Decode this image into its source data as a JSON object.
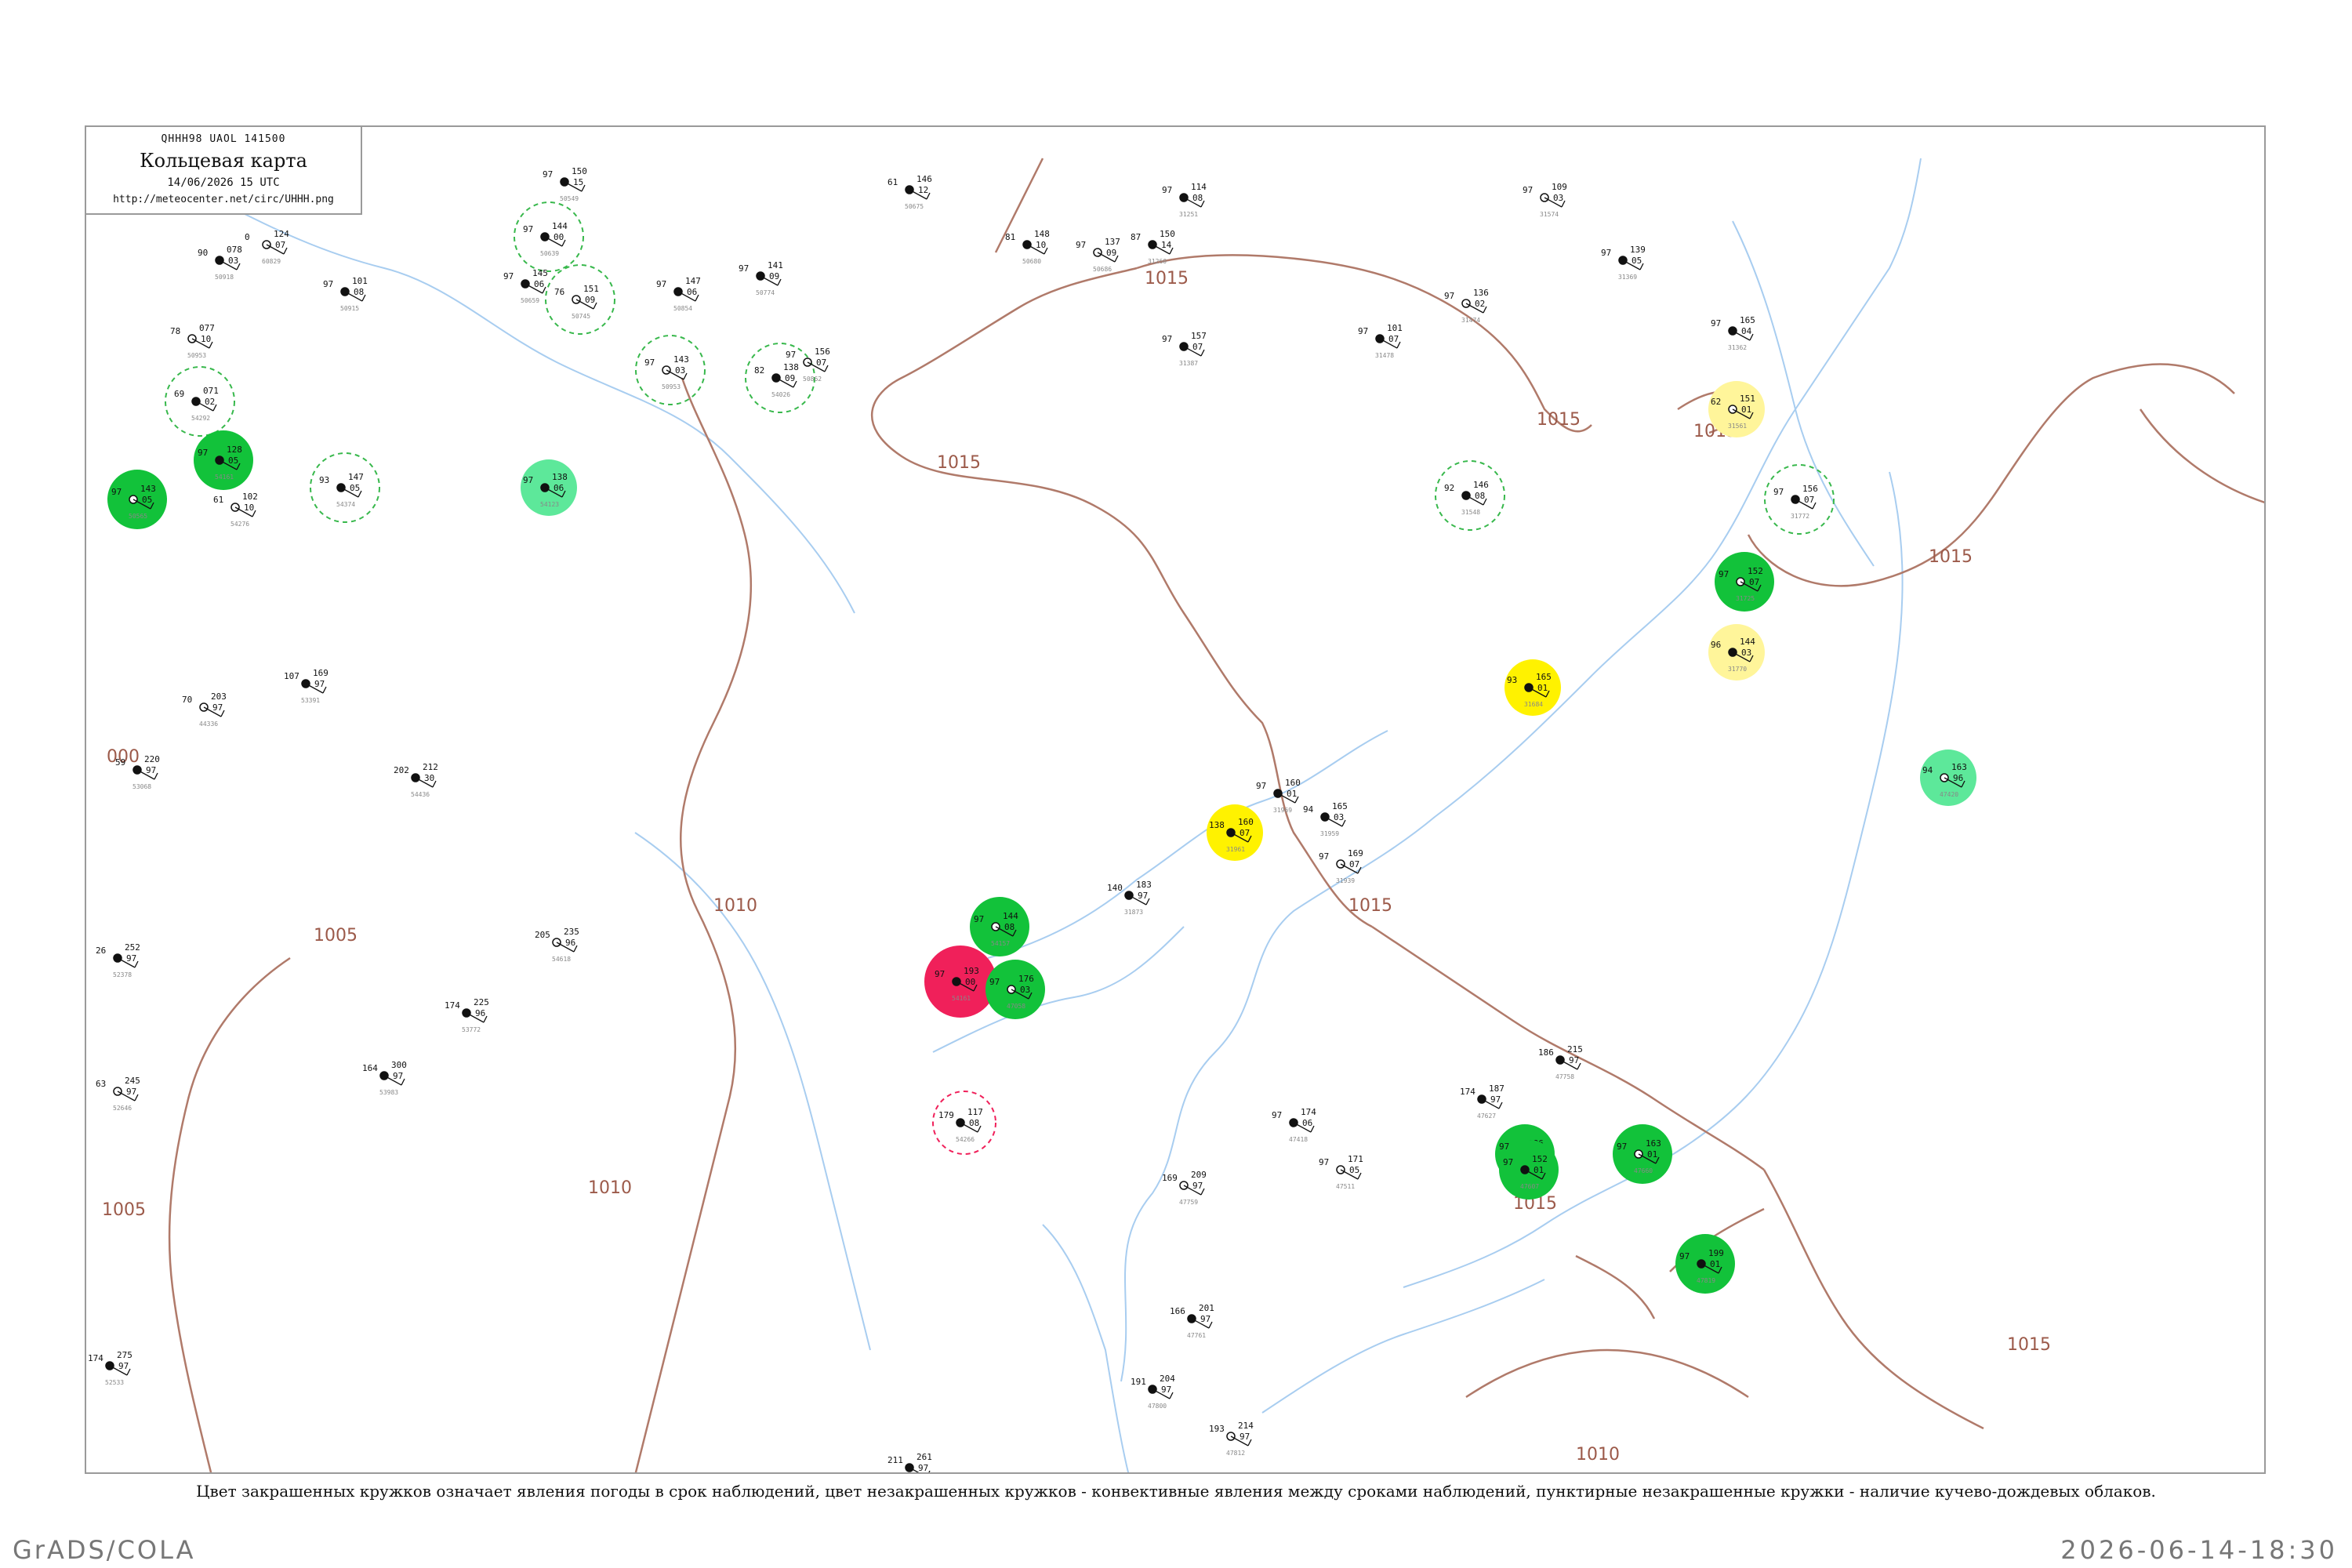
{
  "header": {
    "code": "QHHH98  UAOL  141500",
    "title": "Кольцевая карта",
    "datetime": "14/06/2026 15 UTC",
    "url": "http://meteocenter.net/circ/UHHH.png"
  },
  "caption": "Цвет закрашенных кружков означает явления погоды в срок наблюдений, цвет незакрашенных кружков - конвективные явления между сроками наблюдений, пунктирные незакрашенные кружки - наличие кучево-дождевых облаков.",
  "footer": {
    "left": "GrADS/COLA",
    "right": "2026-06-14-18:30"
  },
  "colors": {
    "isobar": "#b07a6a",
    "river": "#a8cdf0",
    "frame": "#9a9a9a",
    "rain_green": "#12c23a",
    "shower_lightgreen": "#5de89a",
    "fog_yellow": "#fff200",
    "haze_paleyellow": "#fff59a",
    "thunder_red": "#f0205a",
    "dashed_green": "#38b84c",
    "dashed_red": "#f0205a"
  },
  "isobar_labels": [
    "1015",
    "1015",
    "1015",
    "1015",
    "1015",
    "1015",
    "1015",
    "1015",
    "1010",
    "1010",
    "1010",
    "1005",
    "1005",
    "000"
  ],
  "stations": [
    {
      "p": "124",
      "t": "07",
      "ws": "0",
      "n": "60829",
      "fill": "none"
    },
    {
      "p": "078",
      "t": "03",
      "ws": "90",
      "n": "50918",
      "fill": "none"
    },
    {
      "p": "101",
      "t": "08",
      "ws": "97",
      "n": "50915",
      "fill": "none"
    },
    {
      "p": "077",
      "t": "10",
      "ws": "78",
      "n": "50953",
      "fill": "none"
    },
    {
      "p": "071",
      "t": "02",
      "ws": "69",
      "n": "54292",
      "fill": "dashed-green"
    },
    {
      "p": "128",
      "t": "05",
      "ws": "97",
      "n": "54161",
      "fill": "rain"
    },
    {
      "p": "143",
      "t": "05",
      "ws": "97",
      "n": "50565",
      "fill": "rain"
    },
    {
      "p": "147",
      "t": "05",
      "ws": "93",
      "n": "54374",
      "fill": "dashed-green"
    },
    {
      "p": "138",
      "t": "06",
      "ws": "97",
      "n": "54123",
      "fill": "shower"
    },
    {
      "p": "102",
      "t": "10",
      "ws": "61",
      "n": "54276",
      "fill": "none"
    },
    {
      "p": "150",
      "t": "15",
      "ws": "97",
      "n": "50549",
      "fill": "none"
    },
    {
      "p": "144",
      "t": "00",
      "ws": "97",
      "n": "50639",
      "fill": "dashed-green"
    },
    {
      "p": "151",
      "t": "09",
      "ws": "76",
      "n": "50745",
      "fill": "dashed-green"
    },
    {
      "p": "145",
      "t": "06",
      "ws": "97",
      "n": "50659",
      "fill": "none"
    },
    {
      "p": "147",
      "t": "06",
      "ws": "97",
      "n": "50854",
      "fill": "none"
    },
    {
      "p": "143",
      "t": "03",
      "ws": "97",
      "n": "50953",
      "fill": "dashed-green"
    },
    {
      "p": "138",
      "t": "09",
      "ws": "82",
      "n": "54026",
      "fill": "dashed-green"
    },
    {
      "p": "141",
      "t": "09",
      "ws": "97",
      "n": "50774",
      "fill": "none"
    },
    {
      "p": "156",
      "t": "07",
      "ws": "97",
      "n": "50862",
      "fill": "none"
    },
    {
      "p": "146",
      "t": "12",
      "ws": "61",
      "n": "50675",
      "fill": "none"
    },
    {
      "p": "148",
      "t": "10",
      "ws": "81",
      "n": "50680",
      "fill": "none"
    },
    {
      "p": "137",
      "t": "09",
      "ws": "97",
      "n": "50686",
      "fill": "none"
    },
    {
      "p": "150",
      "t": "14",
      "ws": "87",
      "n": "31260",
      "fill": "none"
    },
    {
      "p": "114",
      "t": "08",
      "ws": "97",
      "n": "31251",
      "fill": "none"
    },
    {
      "p": "109",
      "t": "03",
      "ws": "97",
      "n": "31574",
      "fill": "none"
    },
    {
      "p": "157",
      "t": "07",
      "ws": "97",
      "n": "31387",
      "fill": "none"
    },
    {
      "p": "101",
      "t": "07",
      "ws": "97",
      "n": "31478",
      "fill": "none"
    },
    {
      "p": "136",
      "t": "02",
      "ws": "97",
      "n": "31474",
      "fill": "none"
    },
    {
      "p": "139",
      "t": "05",
      "ws": "97",
      "n": "31369",
      "fill": "none"
    },
    {
      "p": "165",
      "t": "04",
      "ws": "97",
      "n": "31362",
      "fill": "none"
    },
    {
      "p": "151",
      "t": "01",
      "ws": "62",
      "n": "31561",
      "fill": "haze"
    },
    {
      "p": "156",
      "t": "07",
      "ws": "97",
      "n": "31772",
      "fill": "dashed-green"
    },
    {
      "p": "146",
      "t": "08",
      "ws": "92",
      "n": "31548",
      "fill": "dashed-green"
    },
    {
      "p": "152",
      "t": "07",
      "ws": "97",
      "n": "31725",
      "fill": "rain"
    },
    {
      "p": "144",
      "t": "03",
      "ws": "96",
      "n": "31770",
      "fill": "haze"
    },
    {
      "p": "165",
      "t": "01",
      "ws": "93",
      "n": "31684",
      "fill": "fog"
    },
    {
      "p": "163",
      "t": "96",
      "ws": "94",
      "n": "47420",
      "fill": "shower"
    },
    {
      "p": "160",
      "t": "07",
      "ws": "138",
      "n": "31961",
      "fill": "fog"
    },
    {
      "p": "165",
      "t": "03",
      "ws": "94",
      "n": "31959",
      "fill": "none"
    },
    {
      "p": "169",
      "t": "07",
      "ws": "97",
      "n": "31939",
      "fill": "none"
    },
    {
      "p": "183",
      "t": "97",
      "ws": "140",
      "n": "31873",
      "fill": "none"
    },
    {
      "p": "160",
      "t": "01",
      "ws": "97",
      "n": "31969",
      "fill": "none"
    },
    {
      "p": "144",
      "t": "08",
      "ws": "97",
      "n": "54157",
      "fill": "rain"
    },
    {
      "p": "193",
      "t": "00",
      "ws": "97",
      "n": "54161",
      "fill": "thunder"
    },
    {
      "p": "117",
      "t": "08",
      "ws": "179",
      "n": "54266",
      "fill": "dashed-red"
    },
    {
      "p": "176",
      "t": "03",
      "ws": "97",
      "n": "47058",
      "fill": "rain"
    },
    {
      "p": "186",
      "t": "04",
      "ws": "97",
      "n": "47805",
      "fill": "rain"
    },
    {
      "p": "152",
      "t": "01",
      "ws": "97",
      "n": "47607",
      "fill": "rain"
    },
    {
      "p": "163",
      "t": "01",
      "ws": "97",
      "n": "47660",
      "fill": "rain"
    },
    {
      "p": "199",
      "t": "01",
      "ws": "97",
      "n": "47819",
      "fill": "rain"
    },
    {
      "p": "174",
      "t": "06",
      "ws": "97",
      "n": "47418",
      "fill": "none"
    },
    {
      "p": "171",
      "t": "05",
      "ws": "97",
      "n": "47511",
      "fill": "none"
    },
    {
      "p": "187",
      "t": "97",
      "ws": "174",
      "n": "47627",
      "fill": "none"
    },
    {
      "p": "215",
      "t": "97",
      "ws": "186",
      "n": "47758",
      "fill": "none"
    },
    {
      "p": "209",
      "t": "97",
      "ws": "169",
      "n": "47759",
      "fill": "none"
    },
    {
      "p": "201",
      "t": "97",
      "ws": "166",
      "n": "47761",
      "fill": "none"
    },
    {
      "p": "204",
      "t": "97",
      "ws": "191",
      "n": "47800",
      "fill": "none"
    },
    {
      "p": "214",
      "t": "97",
      "ws": "193",
      "n": "47812",
      "fill": "none"
    },
    {
      "p": "261",
      "t": "97",
      "ws": "211",
      "n": "52418",
      "fill": "none"
    },
    {
      "p": "275",
      "t": "97",
      "ws": "174",
      "n": "52533",
      "fill": "none"
    },
    {
      "p": "245",
      "t": "97",
      "ws": "63",
      "n": "52646",
      "fill": "none"
    },
    {
      "p": "252",
      "t": "97",
      "ws": "26",
      "n": "52378",
      "fill": "none"
    },
    {
      "p": "220",
      "t": "97",
      "ws": "59",
      "n": "53068",
      "fill": "none"
    },
    {
      "p": "203",
      "t": "97",
      "ws": "70",
      "n": "44336",
      "fill": "none"
    },
    {
      "p": "169",
      "t": "97",
      "ws": "107",
      "n": "53391",
      "fill": "none"
    },
    {
      "p": "212",
      "t": "30",
      "ws": "202",
      "n": "54436",
      "fill": "none"
    },
    {
      "p": "235",
      "t": "96",
      "ws": "205",
      "n": "54618",
      "fill": "none"
    },
    {
      "p": "225",
      "t": "96",
      "ws": "174",
      "n": "53772",
      "fill": "none"
    },
    {
      "p": "300",
      "t": "97",
      "ws": "164",
      "n": "53983",
      "fill": "none"
    }
  ]
}
